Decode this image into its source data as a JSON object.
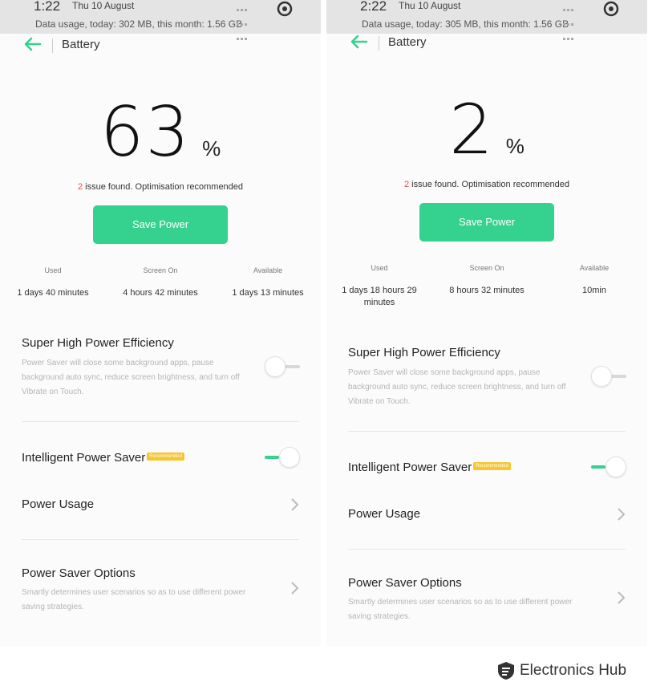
{
  "screens": [
    {
      "status": {
        "time": "1:22",
        "date": "Thu 10 August",
        "data_usage": "Data usage, today: 302 MB, this month: 1.56 GB"
      },
      "appbar_title": "Battery",
      "battery_percent": "63",
      "percent_sign": "%",
      "issue_count": "2",
      "issue_text": " issue found. Optimisation recommended",
      "save_button": "Save Power",
      "stats": [
        {
          "label": "Used",
          "value": "1 days 40 minutes"
        },
        {
          "label": "Screen On",
          "value": "4 hours 42 minutes"
        },
        {
          "label": "Available",
          "value": "1 days 13 minutes"
        }
      ],
      "super_high": {
        "title": "Super High Power Efficiency",
        "desc": "Power Saver will close some background apps, pause background auto sync, reduce screen brightness, and turn off Vibrate on Touch.",
        "enabled": false
      },
      "intelligent": {
        "title": "Intelligent Power Saver",
        "badge": "Recommended",
        "enabled": true
      },
      "power_usage": {
        "title": "Power Usage"
      },
      "power_saver_options": {
        "title": "Power Saver Options",
        "desc": "Smartly determines user scenarios so as to use different power saving strategies."
      }
    },
    {
      "status": {
        "time": "2:22",
        "date": "Thu 10 August",
        "data_usage": "Data usage, today: 305 MB, this month: 1.56 GB"
      },
      "appbar_title": "Battery",
      "battery_percent": "2",
      "percent_sign": "%",
      "issue_count": "2",
      "issue_text": " issue found. Optimisation recommended",
      "save_button": "Save Power",
      "stats": [
        {
          "label": "Used",
          "value": "1 days 18 hours 29 minutes"
        },
        {
          "label": "Screen On",
          "value": "8 hours 32 minutes"
        },
        {
          "label": "Available",
          "value": "10min"
        }
      ],
      "super_high": {
        "title": "Super High Power Efficiency",
        "desc": "Power Saver will close some background apps, pause background auto sync, reduce screen brightness, and turn off Vibrate on Touch.",
        "enabled": false
      },
      "intelligent": {
        "title": "Intelligent Power Saver",
        "badge": "Recommended",
        "enabled": true
      },
      "power_usage": {
        "title": "Power Usage"
      },
      "power_saver_options": {
        "title": "Power Saver Options",
        "desc": "Smartly determines user scenarios so as to use different power saving strategies."
      }
    }
  ],
  "brand": {
    "name": "Electronics",
    "suffix": "Hub"
  },
  "colors": {
    "accent": "#35d18e",
    "issue": "#d9534f",
    "badge": "#f6c530",
    "statusbar": "#e4e4e4"
  }
}
